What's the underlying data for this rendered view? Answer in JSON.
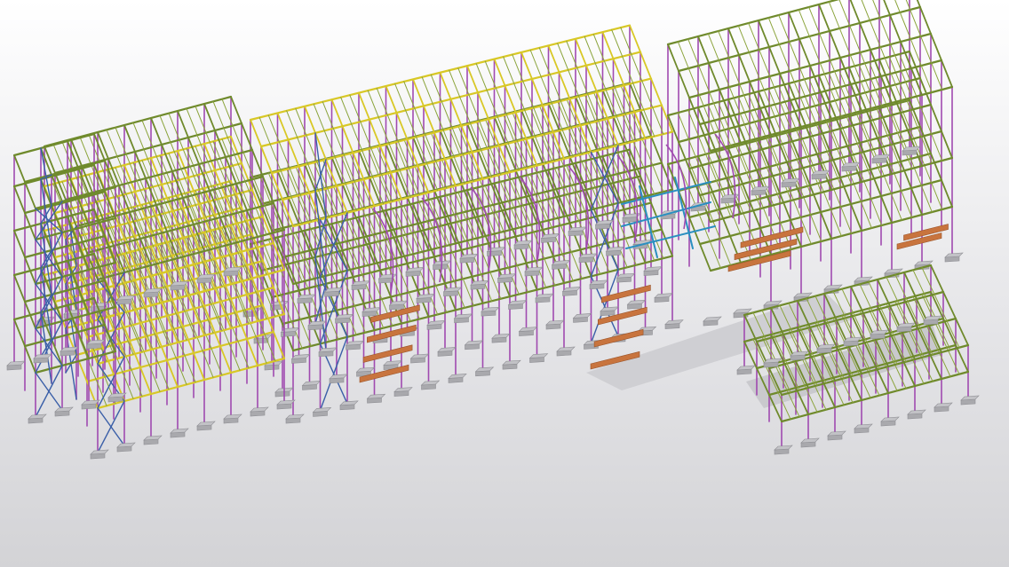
{
  "view": {
    "kind": "3d-structural-model-viewport",
    "background_top": "#ffffff",
    "background_bottom": "#d3d3d6"
  },
  "colors": {
    "beam_green": "#6f8a2c",
    "beam_green_light": "#8aa33a",
    "beam_yellow": "#d8c826",
    "column_purple": "#a04ab0",
    "brace_blue": "#3a5fa8",
    "beam_cyan": "#2a8fc0",
    "stair_orange": "#c8743e",
    "footing_gray": "#a9a9ad",
    "slab_gray": "#c4c4c8"
  },
  "model": {
    "sections": [
      "left-tower",
      "left-yellow-block",
      "main-long-block",
      "right-roof-block",
      "lower-right-annex"
    ],
    "element_types": [
      "beam",
      "column",
      "brace",
      "stair",
      "footing"
    ]
  }
}
